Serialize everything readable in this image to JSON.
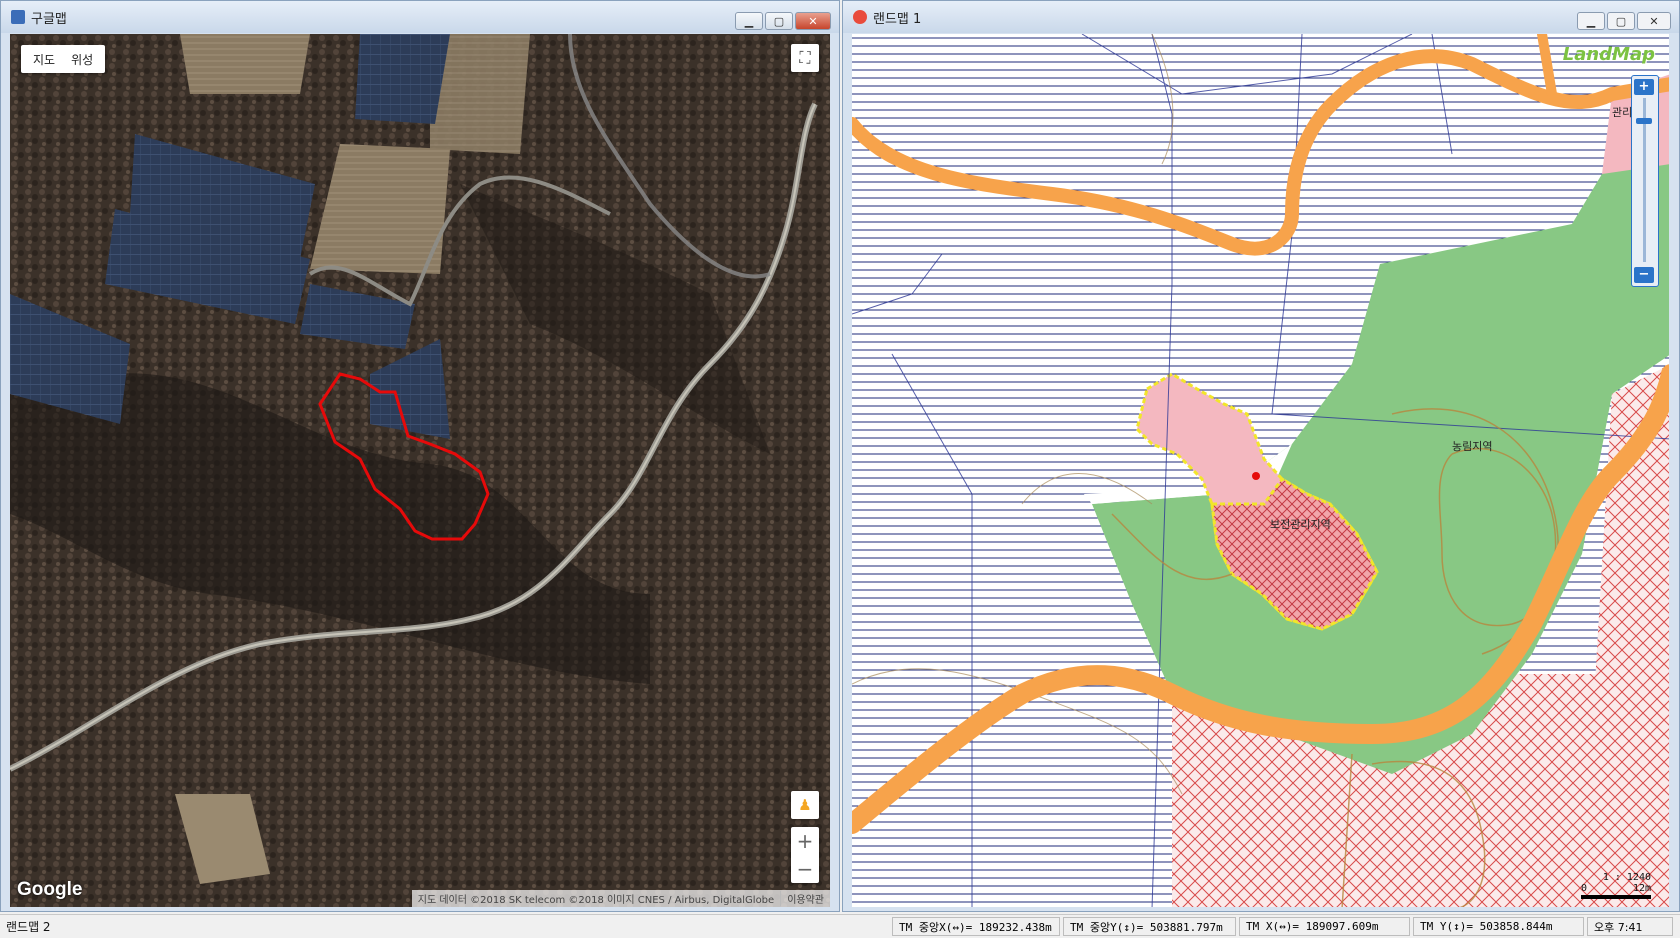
{
  "left_window": {
    "title": "구글맵",
    "map_type_buttons": [
      "지도",
      "위성"
    ],
    "fullscreen_icon": "fullscreen-icon",
    "pegman_icon": "pegman-icon",
    "zoom_in_label": "+",
    "zoom_out_label": "−",
    "logo": "Google",
    "attribution": "지도 데이터 ©2018 SK telecom ©2018 이미지 CNES / Airbus, DigitalGlobe",
    "terms": "이용약관"
  },
  "right_window": {
    "title": "랜드맵 1",
    "logo": "LandMap",
    "zoom_in_label": "+",
    "zoom_out_label": "−",
    "labels": {
      "agriculture_forest": "농림지역",
      "conservation_management": "보전관리지역",
      "management": "관리지"
    },
    "scale_ratio": "1 : 1240",
    "scale_start": "0",
    "scale_distance": "12m",
    "colors": {
      "road": "#f7a34b",
      "forest_zone": "#88c884",
      "conservation_zone": "#f4b8c0",
      "hatch_lines": "#1e2a78",
      "selected_outline": "#f2e62a"
    }
  },
  "status_bar": {
    "app_name": "랜드맵 2",
    "tm_center_x": "TM 중앙X(↔)= 189232.438m",
    "tm_center_y": "TM 중앙Y(↕)= 503881.797m",
    "tm_x": "TM X(↔)= 189097.609m",
    "tm_y": "TM Y(↕)= 503858.844m",
    "time": "오후 7:41"
  },
  "window_controls": [
    "minimize-icon",
    "maximize-icon",
    "close-icon"
  ]
}
